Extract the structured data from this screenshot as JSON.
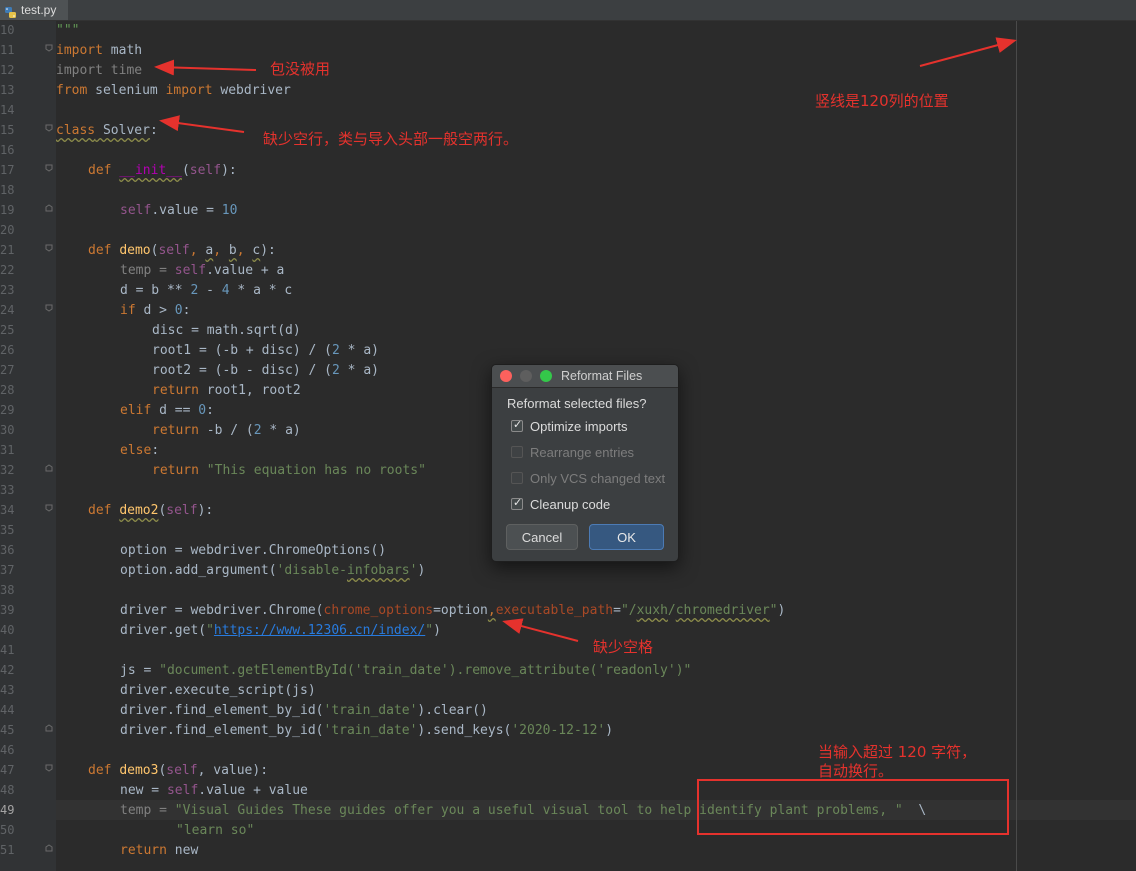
{
  "tab": {
    "file_name": "test.py",
    "icon": "python-file-icon"
  },
  "line_numbers": [
    "10",
    "11",
    "12",
    "13",
    "14",
    "15",
    "16",
    "17",
    "18",
    "19",
    "20",
    "21",
    "22",
    "23",
    "24",
    "25",
    "26",
    "27",
    "28",
    "29",
    "30",
    "31",
    "32",
    "33",
    "34",
    "35",
    "36",
    "37",
    "38",
    "39",
    "40",
    "41",
    "42",
    "43",
    "44",
    "45",
    "46",
    "47",
    "48",
    "49",
    "50",
    "51"
  ],
  "current_line": "49",
  "code": {
    "l10": "\"\"\"",
    "l11_kw": "import",
    "l11_rest": " math",
    "l12_kw": "import",
    "l12_rest": " time",
    "l13_kw1": "from",
    "l13_mid": " selenium ",
    "l13_kw2": "import",
    "l13_rest": " webdriver",
    "l15_kw": "class",
    "l15_name": " Solver",
    "l15_colon": ":",
    "l17_kw": "def ",
    "l17_fn": "__init__",
    "l17_p1": "(",
    "l17_self": "self",
    "l17_p2": "):",
    "l19_self": "self",
    "l19_mid": ".value = ",
    "l19_num": "10",
    "l21_kw": "def ",
    "l21_fn": "demo",
    "l21_p1": "(",
    "l21_self": "self",
    "l21_c1": ", ",
    "l21_a": "a",
    "l21_c2": ", ",
    "l21_b": "b",
    "l21_c3": ", ",
    "l21_c": "c",
    "l21_p2": "):",
    "l22_a": "temp = ",
    "l22_self": "self",
    "l22_b": ".value + a",
    "l23_a": "d = b ** ",
    "l23_n1": "2",
    "l23_b": " - ",
    "l23_n2": "4",
    "l23_c": " * a * c",
    "l24_kw": "if",
    "l24_a": " d > ",
    "l24_n": "0",
    "l24_b": ":",
    "l25": "disc = math.sqrt(d)",
    "l26_a": "root1 = (-b + disc) / (",
    "l26_n": "2",
    "l26_b": " * a)",
    "l27_a": "root2 = (-b - disc) / (",
    "l27_n": "2",
    "l27_b": " * a)",
    "l28_kw": "return",
    "l28_rest": " root1, root2",
    "l29_kw": "elif",
    "l29_a": " d == ",
    "l29_n": "0",
    "l29_b": ":",
    "l30_kw": "return",
    "l30_a": " -b / (",
    "l30_n": "2",
    "l30_b": " * a)",
    "l31_kw": "else",
    "l31_b": ":",
    "l32_kw": "return ",
    "l32_str": "\"This equation has no roots\"",
    "l34_kw": "def ",
    "l34_fn": "demo2",
    "l34_p1": "(",
    "l34_self": "self",
    "l34_p2": "):",
    "l36": "option = webdriver.ChromeOptions()",
    "l37_a": "option.add_argument(",
    "l37_str1": "'disable-",
    "l37_str2": "infobars",
    "l37_str3": "'",
    "l37_b": ")",
    "l39_a": "driver = webdriver.Chrome(",
    "l39_p1": "chrome_options",
    "l39_b": "=option",
    "l39_c": ",",
    "l39_p2": "executable_path",
    "l39_d": "=",
    "l39_s1": "\"/",
    "l39_s2": "xuxh",
    "l39_s3": "/",
    "l39_s4": "chromedriver",
    "l39_s5": "\"",
    "l39_e": ")",
    "l40_a": "driver.get(",
    "l40_q1": "\"",
    "l40_url": "https://www.12306.cn/index/",
    "l40_q2": "\"",
    "l40_b": ")",
    "l42_a": "js = ",
    "l42_str": "\"document.getElementById('train_date').remove_attribute('readonly')\"",
    "l43": "driver.execute_script(js)",
    "l44_a": "driver.find_element_by_id(",
    "l44_str": "'train_date'",
    "l44_b": ").clear()",
    "l45_a": "driver.find_element_by_id(",
    "l45_str": "'train_date'",
    "l45_b": ").send_keys(",
    "l45_str2": "'2020-12-12'",
    "l45_c": ")",
    "l47_kw": "def ",
    "l47_fn": "demo3",
    "l47_p1": "(",
    "l47_self": "self",
    "l47_p2": ", value):",
    "l48_a": "new = ",
    "l48_self": "self",
    "l48_b": ".value + value",
    "l49_a": "temp = ",
    "l49_str": "\"Visual Guides These guides offer you a useful visual tool to help identify plant problems, \"",
    "l49_b": "  \\",
    "l50_str": "\"learn so\"",
    "l51_kw": "return",
    "l51_rest": " new"
  },
  "annotations": {
    "unused_import": "包没被用",
    "guide_position": "竖线是120列的位置",
    "missing_blank_lines": "缺少空行，类与导入头部一般空两行。",
    "missing_space": "缺少空格",
    "auto_wrap_line1": "当输入超过 120 字符，",
    "auto_wrap_line2": "自动换行。"
  },
  "dialog": {
    "title": "Reformat Files",
    "question": "Reformat selected files?",
    "options": [
      {
        "label": "Optimize imports",
        "checked": true,
        "enabled": true
      },
      {
        "label": "Rearrange entries",
        "checked": false,
        "enabled": false
      },
      {
        "label": "Only VCS changed text",
        "checked": false,
        "enabled": false
      },
      {
        "label": "Cleanup code",
        "checked": true,
        "enabled": true
      }
    ],
    "cancel_label": "Cancel",
    "ok_label": "OK",
    "check_glyph": "✓"
  },
  "colors": {
    "editor_bg": "#2b2b2b",
    "keyword": "#cc7832",
    "string": "#6a8759",
    "number": "#6897bb",
    "self": "#94558d",
    "function": "#ffc66d",
    "annotation": "#e5322d",
    "ok_button": "#365880"
  }
}
